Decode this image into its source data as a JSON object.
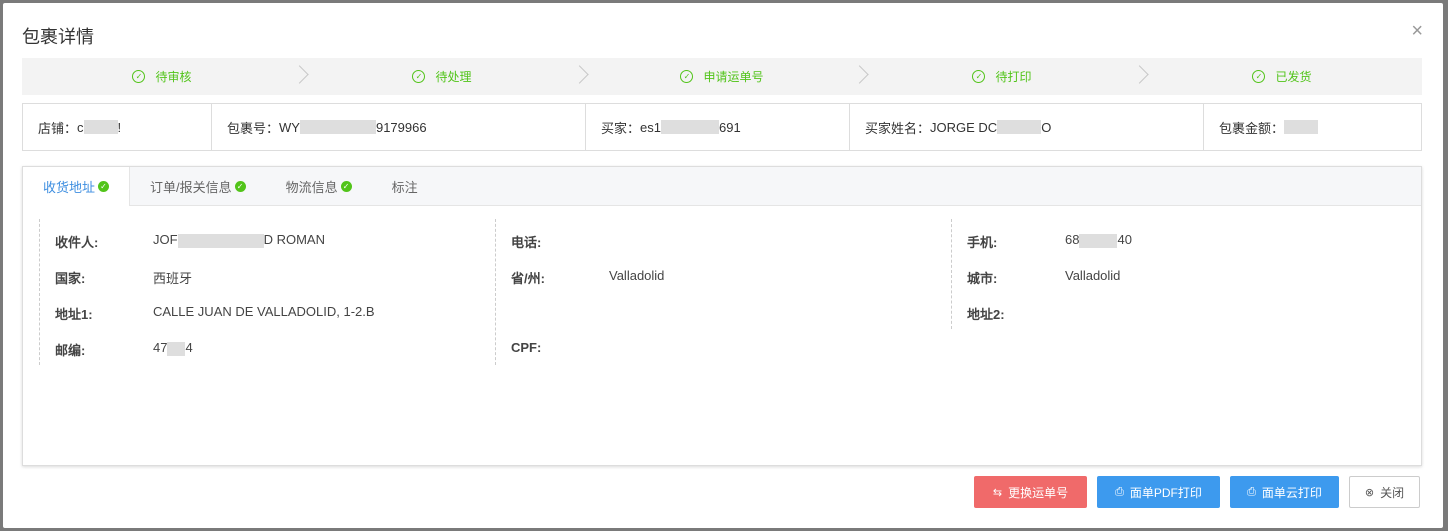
{
  "dialog": {
    "title": "包裹详情",
    "close_glyph": "×"
  },
  "steps": [
    {
      "label": "待审核"
    },
    {
      "label": "待处理"
    },
    {
      "label": "申请运单号"
    },
    {
      "label": "待打印"
    },
    {
      "label": "已发货"
    }
  ],
  "info_bar": {
    "shop": {
      "label": "店铺：",
      "value_prefix": "c",
      "value_suffix": "!"
    },
    "package_no": {
      "label": "包裹号：",
      "value_prefix": "WY",
      "value_suffix": "9179966"
    },
    "buyer": {
      "label": "买家：",
      "value_prefix": "es1",
      "value_suffix": "691"
    },
    "buyer_name": {
      "label": "买家姓名：",
      "value_prefix": "JORGE DC",
      "value_suffix": "O"
    },
    "amount": {
      "label": "包裹金额：",
      "value_prefix": "",
      "value_suffix": ""
    }
  },
  "tabs": [
    {
      "label": "收货地址",
      "checked": true,
      "active": true
    },
    {
      "label": "订单/报关信息",
      "checked": true,
      "active": false
    },
    {
      "label": "物流信息",
      "checked": true,
      "active": false
    },
    {
      "label": "标注",
      "checked": false,
      "active": false
    }
  ],
  "address": {
    "recipient": {
      "label": "收件人:",
      "value_prefix": "JOF",
      "value_suffix": "D ROMAN"
    },
    "country": {
      "label": "国家:",
      "value": "西班牙"
    },
    "address1": {
      "label": "地址1:",
      "value": "CALLE JUAN DE VALLADOLID, 1-2.B"
    },
    "postcode": {
      "label": "邮编:",
      "value_prefix": "47",
      "value_suffix": "4"
    },
    "phone": {
      "label": "电话:",
      "value": ""
    },
    "province": {
      "label": "省/州:",
      "value": "Valladolid"
    },
    "cpf": {
      "label": "CPF:",
      "value": ""
    },
    "mobile": {
      "label": "手机:",
      "value_prefix": "68",
      "value_suffix": "40"
    },
    "city": {
      "label": "城市:",
      "value": "Valladolid"
    },
    "address2": {
      "label": "地址2:",
      "value": ""
    }
  },
  "buttons": {
    "change_tracking": {
      "label": "更换运单号",
      "icon": "swap-icon",
      "color": "#f06a6a"
    },
    "pdf_print": {
      "label": "面单PDF打印",
      "icon": "printer-icon",
      "color": "#3d9aee"
    },
    "cloud_print": {
      "label": "面单云打印",
      "icon": "printer-icon",
      "color": "#3d9aee"
    },
    "close": {
      "label": "关闭",
      "icon": "close-circle-icon",
      "color": "#ffffff"
    }
  },
  "colors": {
    "success": "#52c41a",
    "tab_active": "#3d8ee0",
    "mask": "#dedede"
  }
}
